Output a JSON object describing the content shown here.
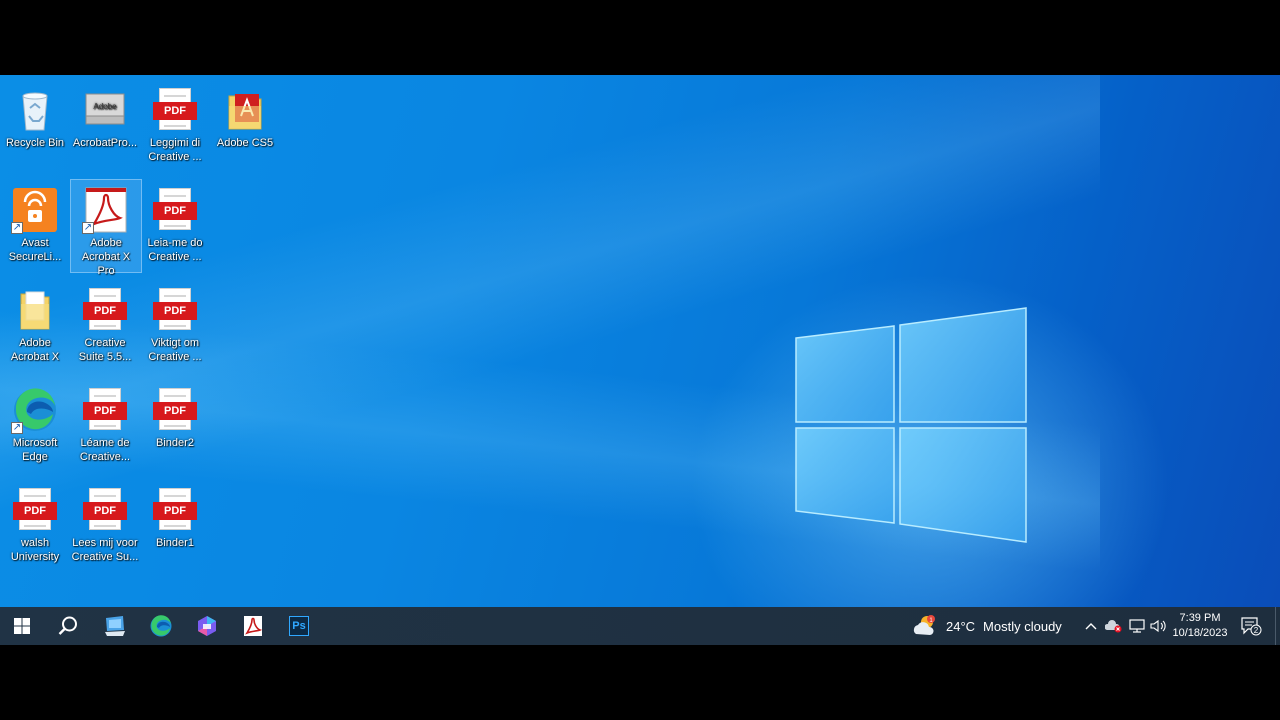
{
  "desktop": {
    "icons": [
      {
        "label": "Recycle Bin"
      },
      {
        "label": "AcrobatPro..."
      },
      {
        "label": "Leggimi di Creative ..."
      },
      {
        "label": "Adobe CS5"
      },
      {
        "label": "Avast SecureLi..."
      },
      {
        "label": "Adobe Acrobat X Pro"
      },
      {
        "label": "Leia-me do Creative ..."
      },
      {
        "label": "Adobe Acrobat X"
      },
      {
        "label": "Creative Suite 5.5..."
      },
      {
        "label": "Viktigt om Creative ..."
      },
      {
        "label": "Microsoft Edge"
      },
      {
        "label": "Léame de Creative..."
      },
      {
        "label": "Binder2"
      },
      {
        "label": "walsh University"
      },
      {
        "label": "Lees mij voor Creative Su..."
      },
      {
        "label": "Binder1"
      }
    ],
    "pdf_badge": "PDF",
    "adobe_box_text": "Adobe"
  },
  "taskbar": {
    "weather_temp": "24°C",
    "weather_desc": "Mostly cloudy",
    "weather_alert": "1",
    "clock_time": "7:39 PM",
    "clock_date": "10/18/2023",
    "notification_count": "2",
    "ps_label": "Ps"
  },
  "colors": {
    "pdf_red": "#d7191c",
    "taskbar_bg": "#1f2f3f",
    "desktop_blue": "#0a86e2"
  }
}
